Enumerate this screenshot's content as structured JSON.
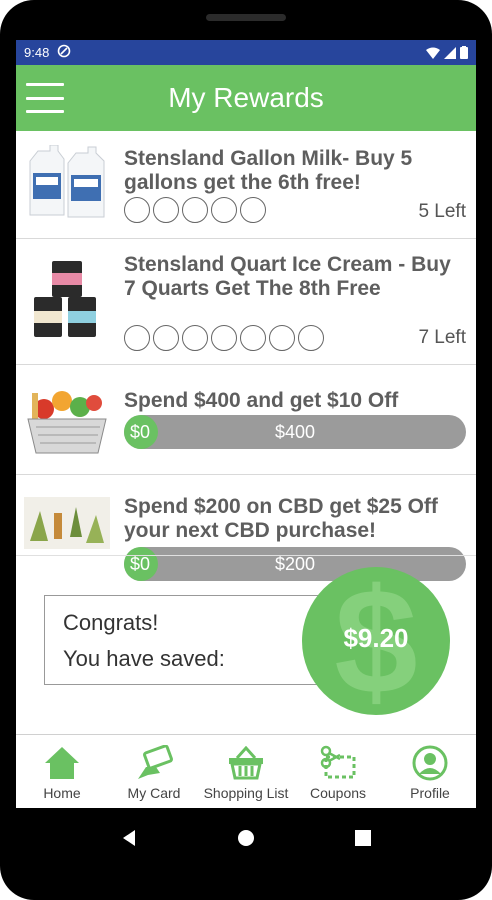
{
  "status": {
    "time": "9:48"
  },
  "header": {
    "title": "My Rewards"
  },
  "rewards": [
    {
      "title": "Stensland Gallon Milk- Buy 5 gallons get the 6th free!",
      "left_text": "5 Left"
    },
    {
      "title": "Stensland Quart Ice Cream - Buy 7 Quarts Get The 8th Free",
      "left_text": "7 Left"
    },
    {
      "title": "Spend $400 and get $10 Off",
      "progress_start": "$0",
      "progress_target": "$400"
    },
    {
      "title": "Spend $200 on CBD get $25 Off your next CBD purchase!",
      "progress_start": "$0",
      "progress_target": "$200"
    }
  ],
  "savings": {
    "line1": "Congrats!",
    "line2": "You have saved:",
    "amount": "$9.20"
  },
  "nav": {
    "home": "Home",
    "card": "My Card",
    "shopping": "Shopping List",
    "coupons": "Coupons",
    "profile": "Profile"
  },
  "colors": {
    "accent": "#6ac162",
    "status_bar": "#27459c"
  }
}
